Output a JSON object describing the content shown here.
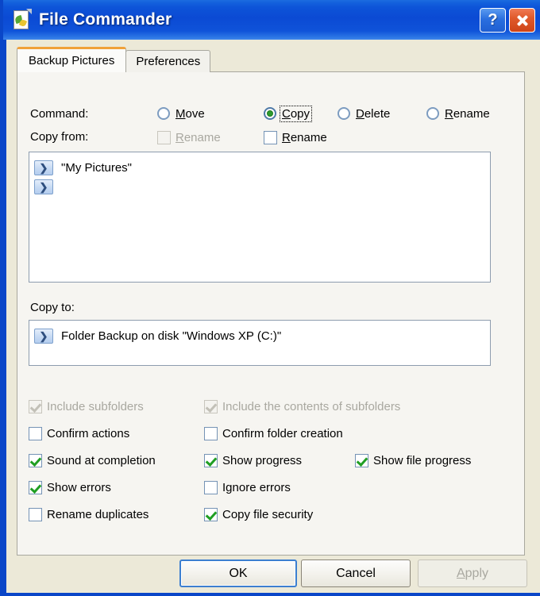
{
  "window": {
    "title": "File Commander",
    "app_icon": "document-leaf-icon",
    "help_button": "?",
    "close_button": "close-icon",
    "frame_color": "#0a46c8",
    "titlebar_color": "#0b4ad4",
    "dialog_background": "#ece9d8"
  },
  "tabs": [
    {
      "label": "Backup Pictures",
      "active": true,
      "accent_color": "#f0a13a"
    },
    {
      "label": "Preferences",
      "active": false
    }
  ],
  "command_row": {
    "label": "Command:",
    "options": [
      {
        "label": "Move",
        "accel": "M",
        "checked": false,
        "focused": false
      },
      {
        "label": "Copy",
        "accel": "C",
        "checked": true,
        "focused": true
      },
      {
        "label": "Delete",
        "accel": "D",
        "checked": false,
        "focused": false
      },
      {
        "label": "Rename",
        "accel": "R",
        "checked": false,
        "focused": false
      }
    ]
  },
  "copy_from": {
    "label": "Copy from:",
    "rename_disabled": {
      "label": "Rename",
      "accel": "R",
      "checked": false,
      "disabled": true
    },
    "rename_enabled": {
      "label": "Rename",
      "accel": "R",
      "checked": false,
      "disabled": false
    },
    "items": [
      {
        "icon": "chevron-right-icon",
        "text": "\"My Pictures\""
      },
      {
        "icon": "chevron-right-icon",
        "text": ""
      }
    ]
  },
  "copy_to": {
    "label": "Copy to:",
    "items": [
      {
        "icon": "chevron-right-icon",
        "text": "Folder Backup on disk \"Windows XP (C:)\""
      }
    ]
  },
  "options": [
    {
      "label": "Include subfolders",
      "checked": true,
      "disabled": true
    },
    {
      "label": "Include the contents of subfolders",
      "checked": true,
      "disabled": true
    },
    {
      "label": "Confirm actions",
      "checked": false,
      "disabled": false
    },
    {
      "label": "Confirm folder creation",
      "checked": false,
      "disabled": false
    },
    {
      "label": "Sound at completion",
      "checked": true,
      "disabled": false
    },
    {
      "label": "Show progress",
      "checked": true,
      "disabled": false
    },
    {
      "label": "Show file progress",
      "checked": true,
      "disabled": false
    },
    {
      "label": "Show errors",
      "checked": true,
      "disabled": false
    },
    {
      "label": "Ignore errors",
      "checked": false,
      "disabled": false
    },
    {
      "label": "Rename duplicates",
      "checked": false,
      "disabled": false
    },
    {
      "label": "Copy file security",
      "checked": true,
      "disabled": false
    }
  ],
  "buttons": {
    "ok": {
      "label": "OK",
      "default": true,
      "disabled": false
    },
    "cancel": {
      "label": "Cancel",
      "default": false,
      "disabled": false
    },
    "apply": {
      "label": "Apply",
      "accel": "A",
      "default": false,
      "disabled": true
    }
  }
}
